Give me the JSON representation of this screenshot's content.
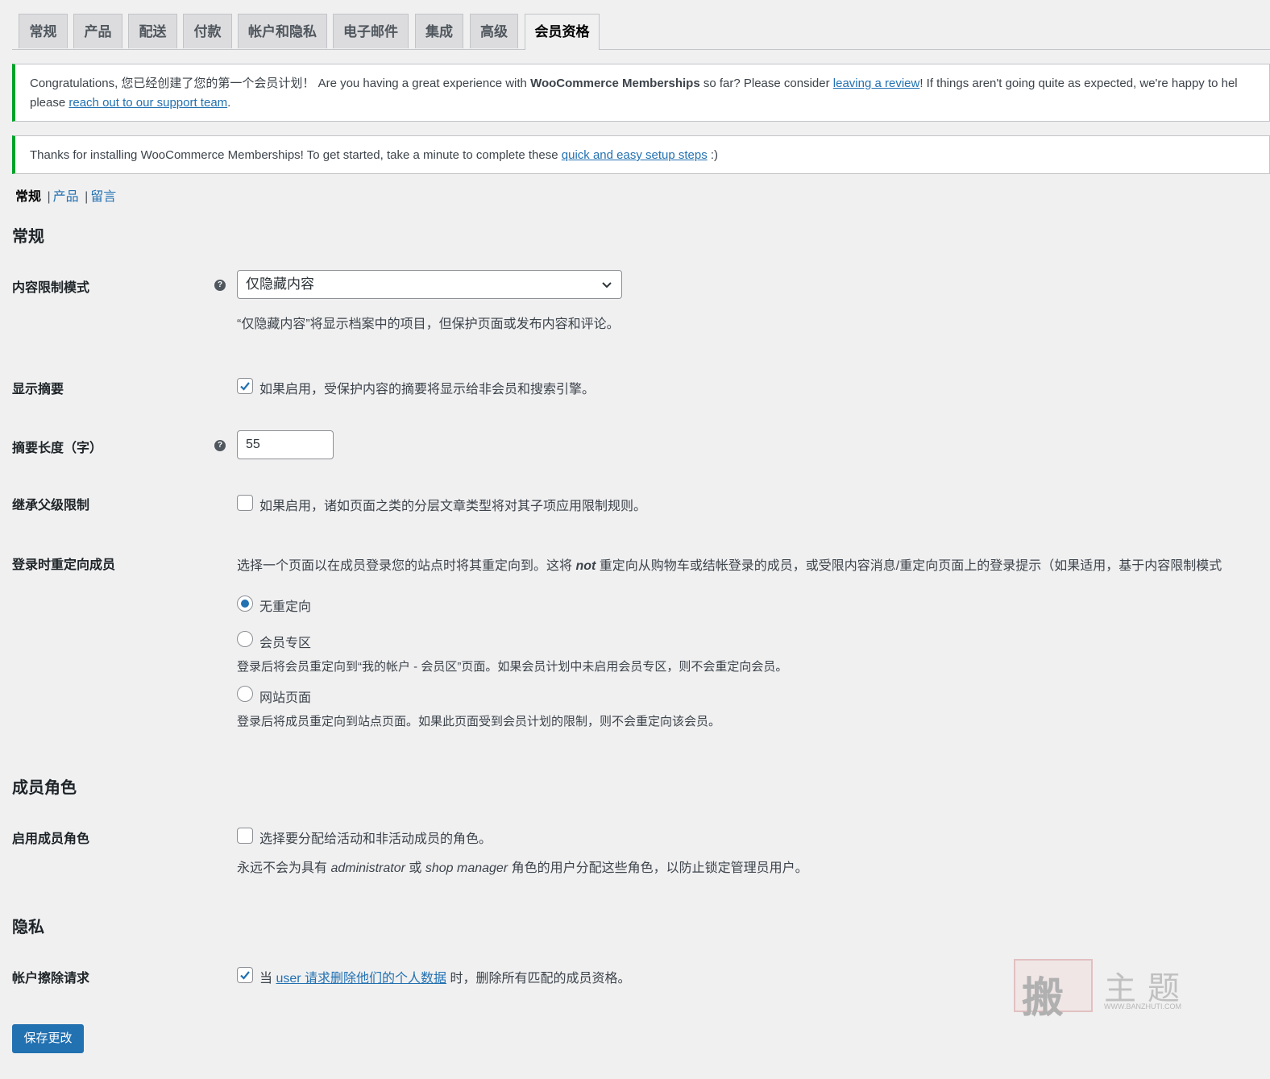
{
  "tabs": [
    {
      "label": "常规",
      "active": false
    },
    {
      "label": "产品",
      "active": false
    },
    {
      "label": "配送",
      "active": false
    },
    {
      "label": "付款",
      "active": false
    },
    {
      "label": "帐户和隐私",
      "active": false
    },
    {
      "label": "电子邮件",
      "active": false
    },
    {
      "label": "集成",
      "active": false
    },
    {
      "label": "高级",
      "active": false
    },
    {
      "label": "会员资格",
      "active": true
    }
  ],
  "notices": {
    "congrats": {
      "text1": "Congratulations, 您已经创建了您的第一个会员计划！  Are you having a great experience with ",
      "product": "WooCommerce Memberships",
      "text2": " so far? Please consider ",
      "review_link": "leaving a review",
      "text3": "! If things aren't going quite as expected, we're happy to hel",
      "text4": "please ",
      "support_link": "reach out to our support team",
      "text5": "."
    },
    "install": {
      "text1": "Thanks for installing WooCommerce Memberships! To get started, take a minute to complete these ",
      "setup_link": "quick and easy setup steps",
      "text2": " :)"
    }
  },
  "subnav": {
    "current": "常规",
    "items": [
      "产品",
      "留言"
    ],
    "separator": "|"
  },
  "sections": {
    "general": "常规",
    "roles": "成员角色",
    "privacy": "隐私"
  },
  "fields": {
    "restriction_mode": {
      "label": "内容限制模式",
      "value": "仅隐藏内容",
      "description": "“仅隐藏内容”将显示档案中的项目，但保护页面或发布内容和评论。"
    },
    "show_excerpts": {
      "label": "显示摘要",
      "checked": true,
      "text": "如果启用，受保护内容的摘要将显示给非会员和搜索引擎。"
    },
    "excerpt_length": {
      "label": "摘要长度（字）",
      "value": "55"
    },
    "inherit_restrictions": {
      "label": "继承父级限制",
      "checked": false,
      "text": "如果启用，诸如页面之类的分层文章类型将对其子项应用限制规则。"
    },
    "login_redirect": {
      "label": "登录时重定向成员",
      "desc_before": "选择一个页面以在成员登录您的站点时将其重定向到。这将 ",
      "desc_em": "not",
      "desc_after": " 重定向从购物车或结帐登录的成员，或受限内容消息/重定向页面上的登录提示（如果适用，基于内容限制模式",
      "options": [
        {
          "label": "无重定向",
          "checked": true,
          "help": ""
        },
        {
          "label": "会员专区",
          "checked": false,
          "help": "登录后将会员重定向到“我的帐户 - 会员区”页面。如果会员计划中未启用会员专区，则不会重定向会员。"
        },
        {
          "label": "网站页面",
          "checked": false,
          "help": "登录后将成员重定向到站点页面。如果此页面受到会员计划的限制，则不会重定向该会员。"
        }
      ]
    },
    "member_roles": {
      "label": "启用成员角色",
      "checked": false,
      "text": "选择要分配给活动和非活动成员的角色。",
      "note_before": "永远不会为具有 ",
      "note_role1": "administrator",
      "note_mid": " 或 ",
      "note_role2": "shop manager",
      "note_after": " 角色的用户分配这些角色，以防止锁定管理员用户。"
    },
    "erasure": {
      "label": "帐户擦除请求",
      "checked": true,
      "text_before": "当 ",
      "link": "user 请求删除他们的个人数据",
      "text_after": " 时，删除所有匹配的成员资格。"
    }
  },
  "save_button": "保存更改",
  "help_icon_glyph": "?",
  "colors": {
    "accent": "#2271b1",
    "notice_success": "#00a32a",
    "background": "#f0f0f1"
  },
  "watermark": {
    "seal_char": "搬",
    "title": "主题",
    "url": "WWW.BANZHUTI.COM"
  }
}
